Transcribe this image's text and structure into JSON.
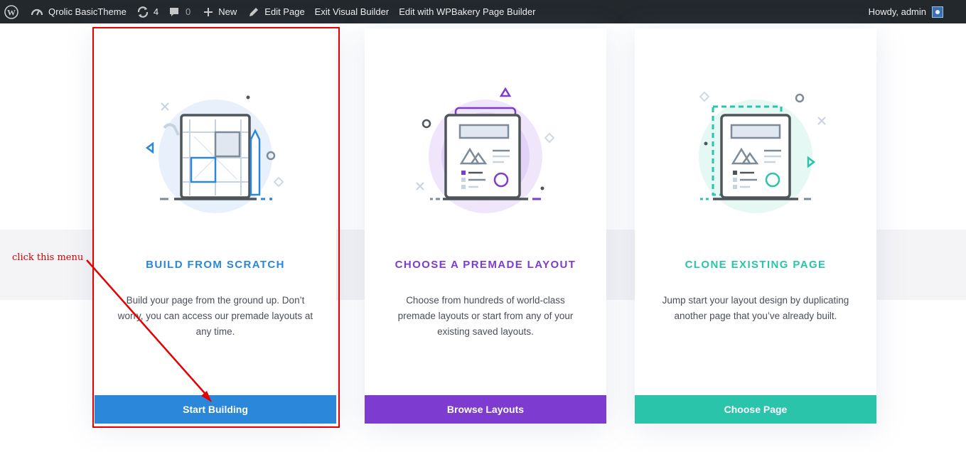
{
  "adminbar": {
    "site_name": "Qrolic BasicTheme",
    "updates_count": "4",
    "comments_count": "0",
    "new_label": "New",
    "edit_page_label": "Edit Page",
    "exit_builder_label": "Exit Visual Builder",
    "wpbakery_label": "Edit with WPBakery Page Builder",
    "howdy_label": "Howdy, admin"
  },
  "cards": [
    {
      "title": "BUILD FROM SCRATCH",
      "description": "Build your page from the ground up. Don’t worry, you can access our premade layouts at any time.",
      "button": "Start Building",
      "accent": "#2b87da"
    },
    {
      "title": "CHOOSE A PREMADE LAYOUT",
      "description": "Choose from hundreds of world-class premade layouts or start from any of your existing saved layouts.",
      "button": "Browse Layouts",
      "accent": "#7e3bd0"
    },
    {
      "title": "CLONE EXISTING PAGE",
      "description": "Jump start your layout design by duplicating another page that you’ve already built.",
      "button": "Choose Page",
      "accent": "#29c4a9"
    }
  ],
  "annotation": {
    "note": "click this menu",
    "color": "#e60000"
  }
}
